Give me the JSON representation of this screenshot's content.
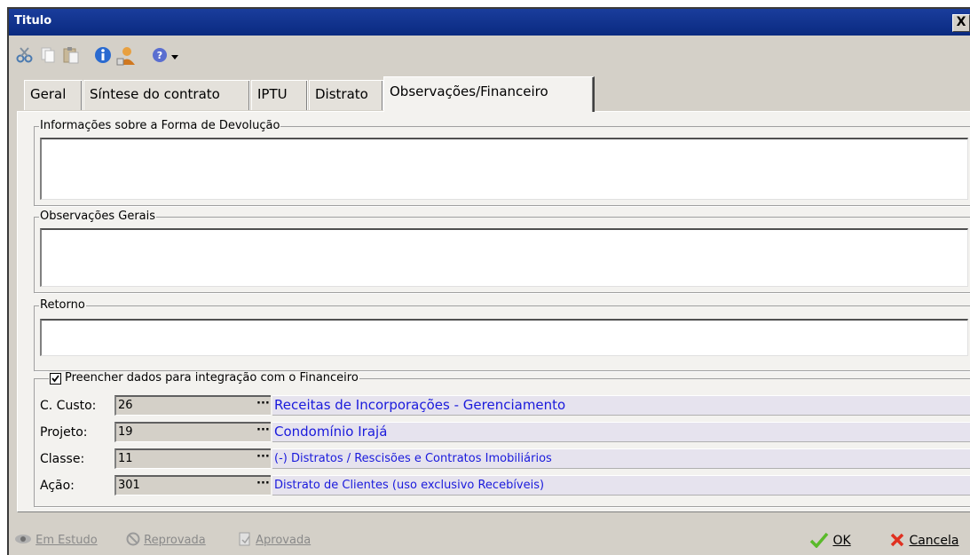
{
  "window": {
    "title": "Titulo",
    "close_glyph": "X"
  },
  "toolbar": {
    "icons": [
      "cut-icon",
      "copy-icon",
      "paste-icon",
      "info-icon",
      "user-icon",
      "help-icon",
      "dropdown-arrow-icon"
    ]
  },
  "tabs": [
    {
      "label": "Geral",
      "active": false
    },
    {
      "label": "Síntese do contrato",
      "active": false
    },
    {
      "label": "IPTU",
      "active": false
    },
    {
      "label": "Distrato",
      "active": false
    },
    {
      "label": "Observações/Financeiro",
      "active": true
    }
  ],
  "groups": {
    "devolucao": {
      "label": "Informações sobre a Forma de Devolução",
      "value": ""
    },
    "observacoes": {
      "label": "Observações Gerais",
      "value": ""
    },
    "retorno": {
      "label": "Retorno",
      "value": ""
    }
  },
  "financeiro": {
    "checkbox_label": "Preencher dados para integração com o Financeiro",
    "checked": true,
    "rows": [
      {
        "label": "C. Custo:",
        "code": "26",
        "description": "Receitas de Incorporações - Gerenciamento"
      },
      {
        "label": "Projeto:",
        "code": "19",
        "description": "Condomínio Irajá"
      },
      {
        "label": "Classe:",
        "code": "11",
        "description": "(-) Distratos / Rescisões e Contratos Imobiliários"
      },
      {
        "label": "Ação:",
        "code": "301",
        "description": "Distrato de Clientes (uso exclusivo Recebíveis)"
      }
    ],
    "ellipsis": "···"
  },
  "statusbar": {
    "em_estudo": "Em Estudo",
    "reprovada": "Reprovada",
    "aprovada": "Aprovada",
    "ok": "OK",
    "cancela": "Cancela"
  }
}
